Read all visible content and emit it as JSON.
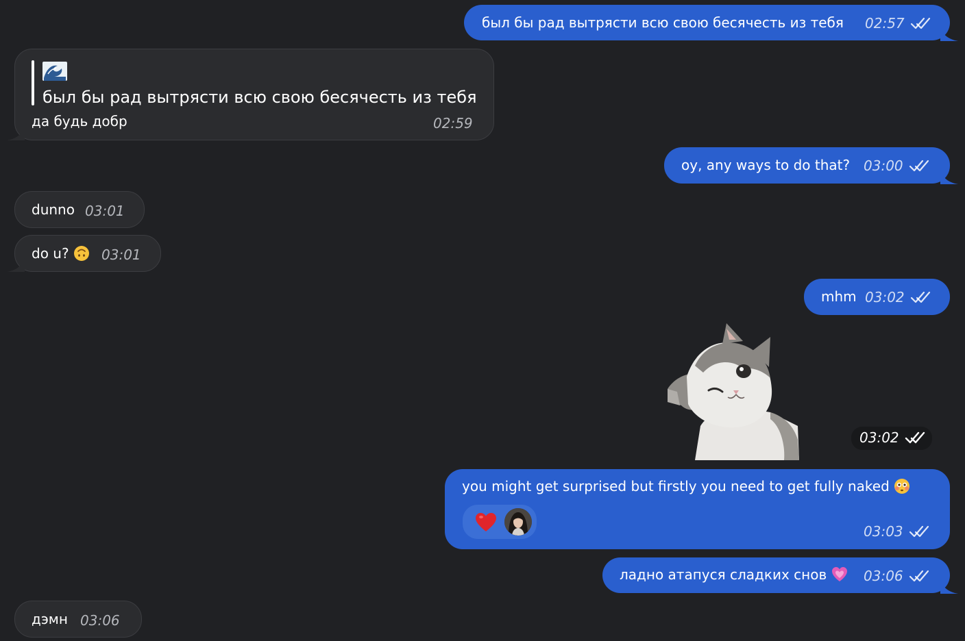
{
  "colors": {
    "background": "#202124",
    "outgoing_bubble": "#2a5fce",
    "incoming_bubble": "#2b2c2f"
  },
  "messages": [
    {
      "direction": "outgoing",
      "text": "был бы рад вытрясти всю свою бесячесть из тебя",
      "time": "02:57",
      "read_icon": "double-check-icon"
    },
    {
      "direction": "incoming",
      "quote_emoji": "wave-emoji",
      "quote_text": "был бы рад вытрясти всю свою бесячесть из тебя",
      "text": "да будь добр",
      "time": "02:59"
    },
    {
      "direction": "outgoing",
      "text": "oy, any ways to do that?",
      "time": "03:00",
      "read_icon": "double-check-icon"
    },
    {
      "direction": "incoming",
      "text": "dunno",
      "time": "03:01"
    },
    {
      "direction": "incoming",
      "text": "do u?",
      "emoji": "upside-down-face-emoji",
      "time": "03:01"
    },
    {
      "direction": "outgoing",
      "text": "mhm",
      "time": "03:02",
      "read_icon": "double-check-icon"
    },
    {
      "direction": "outgoing",
      "type": "sticker",
      "sticker": "winking-cat-sticker",
      "time": "03:02",
      "read_icon": "double-check-icon"
    },
    {
      "direction": "outgoing",
      "text": "you might get surprised but firstly you need to get fully naked",
      "emoji": "flushed-face-emoji",
      "reaction": "red-heart-icon",
      "reactor": "avatar",
      "time": "03:03",
      "read_icon": "double-check-icon"
    },
    {
      "direction": "outgoing",
      "text": "ладно атапуся сладких снов",
      "emoji": "growing-heart-emoji",
      "time": "03:06",
      "read_icon": "double-check-icon"
    },
    {
      "direction": "incoming",
      "text": "дэмн",
      "time": "03:06"
    }
  ]
}
